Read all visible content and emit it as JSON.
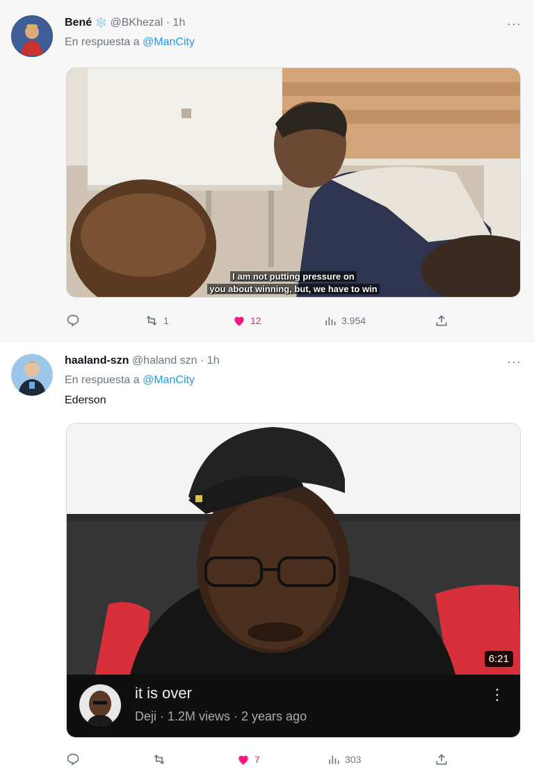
{
  "tweets": [
    {
      "author_name": "Bené",
      "author_emoji": "❄️",
      "handle": "@BKhezal",
      "separator": "·",
      "time": "1h",
      "reply_prefix": "En respuesta a",
      "reply_to": "@ManCity",
      "more": "···",
      "media": {
        "subtitle_line1": "I am not putting pressure on",
        "subtitle_line2": "you about winning, but, we have to win"
      },
      "stats": {
        "retweets": "1",
        "likes": "12",
        "views": "3.954"
      }
    },
    {
      "author_name": "haaland-szn",
      "handle": "@haland szn",
      "separator": "·",
      "time": "1h",
      "reply_prefix": "En respuesta a",
      "reply_to": "@ManCity",
      "more": "···",
      "text": "Ederson",
      "media": {
        "duration": "6:21",
        "video_title": "it is over",
        "video_meta": "Deji · 1.2M views · 2 years ago",
        "menu": "⋮"
      },
      "stats": {
        "retweets": "",
        "likes": "7",
        "views": "303"
      }
    }
  ],
  "icons": {
    "reply": "reply-icon",
    "retweet": "retweet-icon",
    "like": "heart-filled-icon",
    "views": "analytics-icon",
    "share": "share-icon"
  },
  "colors": {
    "mention": "#1d9bf0",
    "like": "#f91880",
    "secondary": "#6b7580"
  }
}
